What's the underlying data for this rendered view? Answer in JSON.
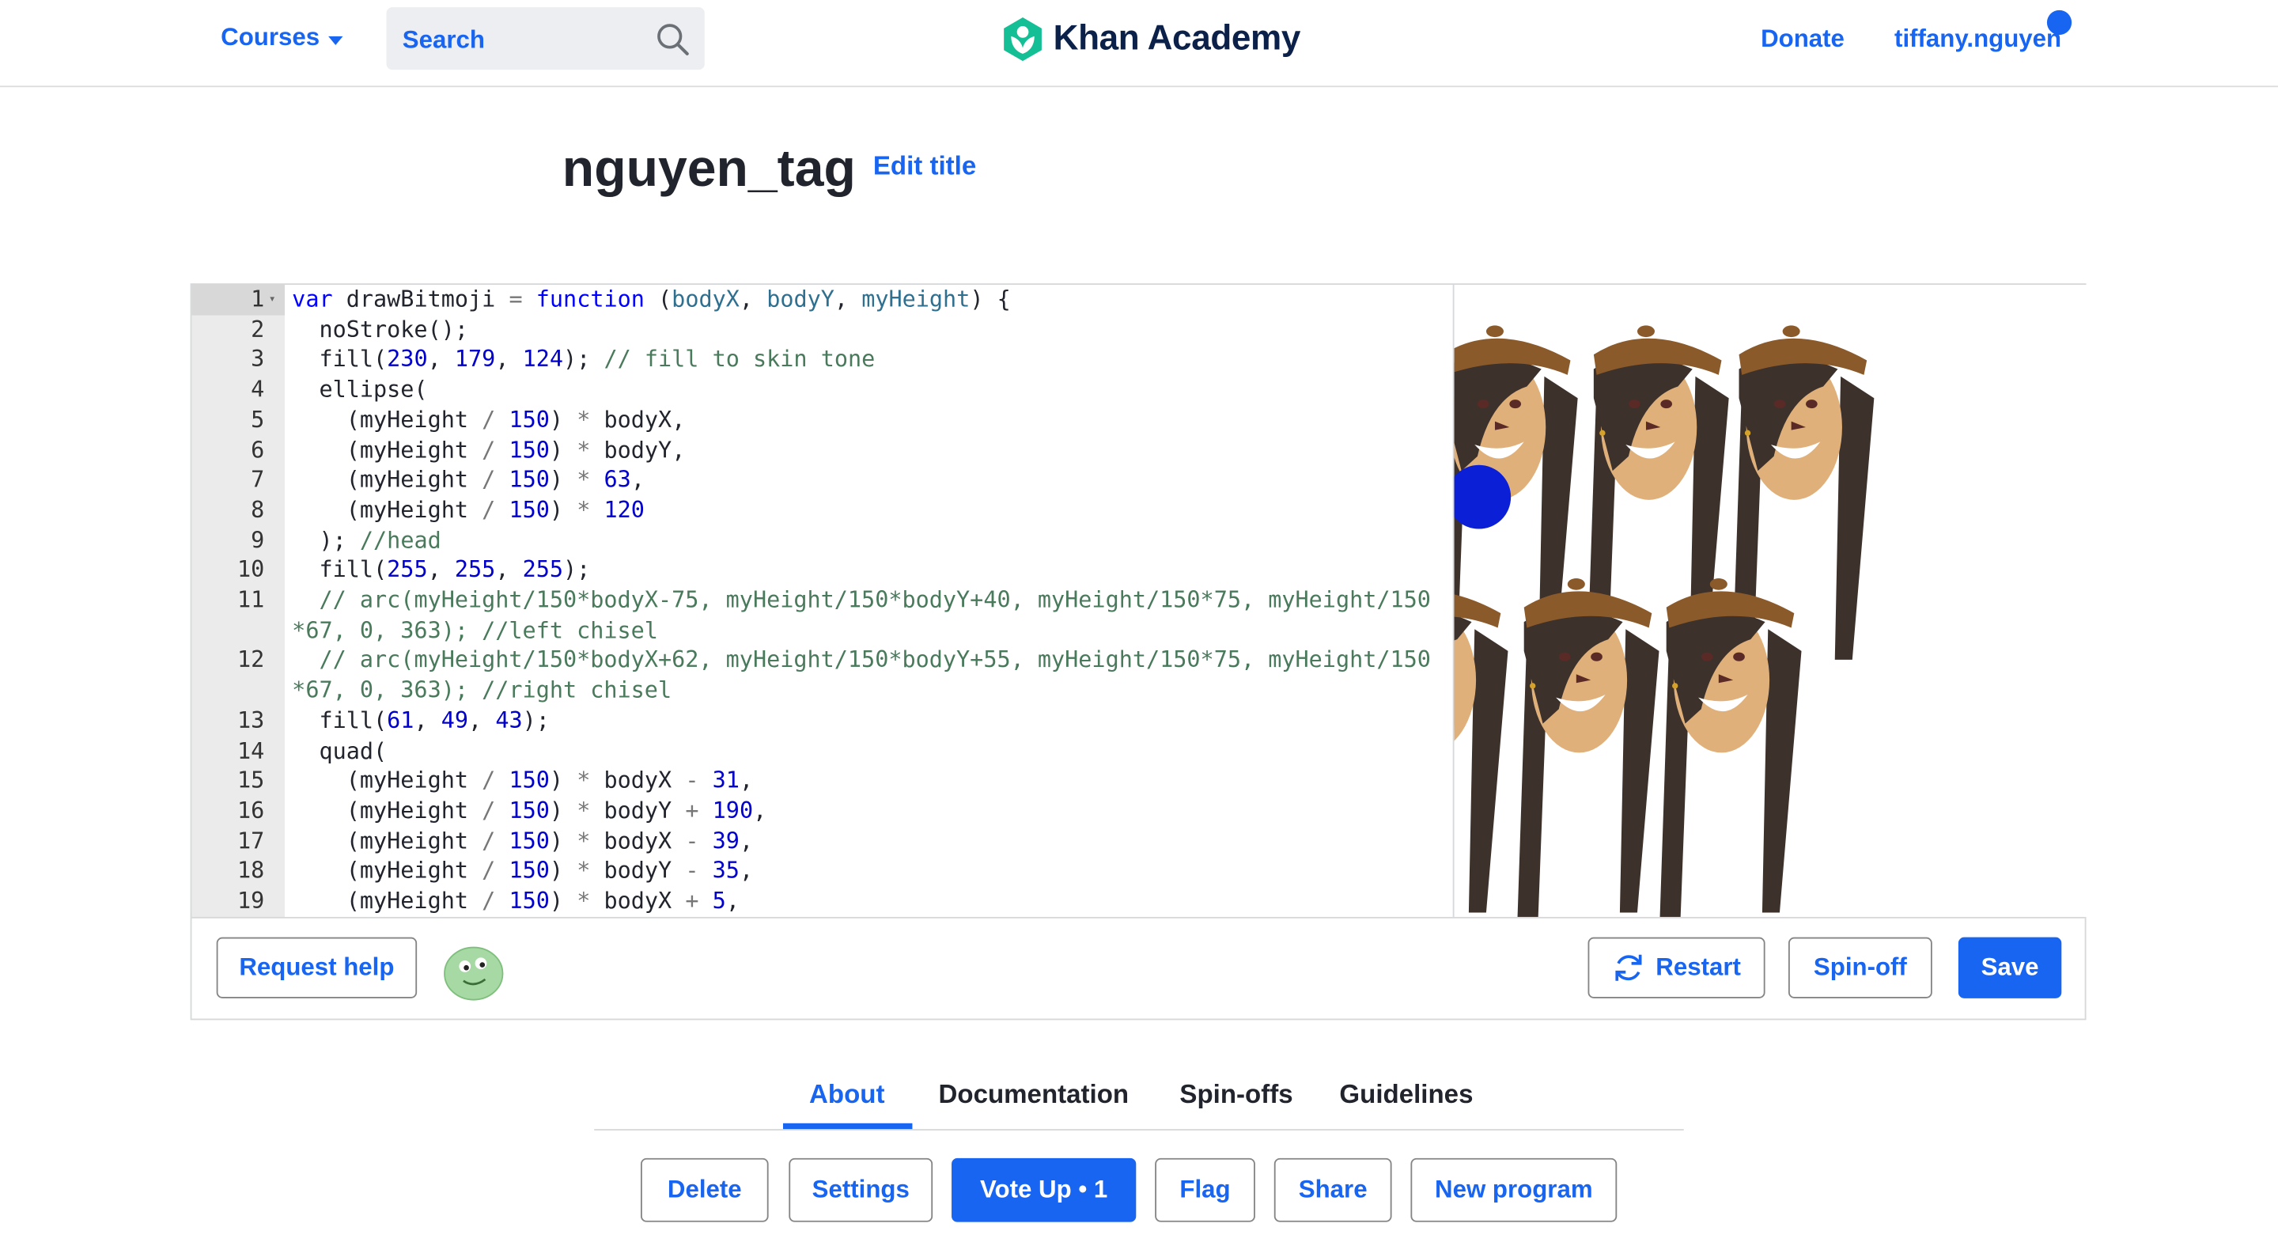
{
  "header": {
    "courses_label": "Courses",
    "search_placeholder": "Search",
    "logo_text": "Khan Academy",
    "donate_label": "Donate",
    "username": "tiffany.nguyen"
  },
  "program": {
    "title": "nguyen_tag",
    "edit_title_label": "Edit title"
  },
  "editor": {
    "line_numbers": [
      "1",
      "2",
      "3",
      "4",
      "5",
      "6",
      "7",
      "8",
      "9",
      "10",
      "11",
      "",
      "12",
      "",
      "13",
      "14",
      "15",
      "16",
      "17",
      "18",
      "19"
    ],
    "code_lines": [
      "var drawBitmoji = function (bodyX, bodyY, myHeight) {",
      "  noStroke();",
      "  fill(230, 179, 124); // fill to skin tone",
      "  ellipse(",
      "    (myHeight / 150) * bodyX,",
      "    (myHeight / 150) * bodyY,",
      "    (myHeight / 150) * 63,",
      "    (myHeight / 150) * 120",
      "  ); //head",
      "  fill(255, 255, 255);",
      "  // arc(myHeight/150*bodyX-75, myHeight/150*bodyY+40, myHeight/150*75, myHeight/150",
      "*67, 0, 363); //left chisel",
      "  // arc(myHeight/150*bodyX+62, myHeight/150*bodyY+55, myHeight/150*75, myHeight/150",
      "*67, 0, 363); //right chisel",
      "  fill(61, 49, 43);",
      "  quad(",
      "    (myHeight / 150) * bodyX - 31,",
      "    (myHeight / 150) * bodyY + 190,",
      "    (myHeight / 150) * bodyX - 39,",
      "    (myHeight / 150) * bodyY - 35,",
      "    (myHeight / 150) * bodyX + 5,"
    ],
    "request_help_label": "Request help",
    "restart_label": "Restart",
    "spinoff_label": "Spin-off",
    "save_label": "Save"
  },
  "tabs": [
    {
      "label": "About",
      "active": true
    },
    {
      "label": "Documentation",
      "active": false
    },
    {
      "label": "Spin-offs",
      "active": false
    },
    {
      "label": "Guidelines",
      "active": false
    }
  ],
  "actions": {
    "delete_label": "Delete",
    "settings_label": "Settings",
    "vote_label": "Vote Up • 1",
    "flag_label": "Flag",
    "share_label": "Share",
    "new_program_label": "New program"
  },
  "colors": {
    "accent": "#1865f2",
    "skin": "#e6b37c",
    "hair": "#3d312b",
    "hat": "#8b5a2b",
    "dot": "#0a1fd6"
  }
}
